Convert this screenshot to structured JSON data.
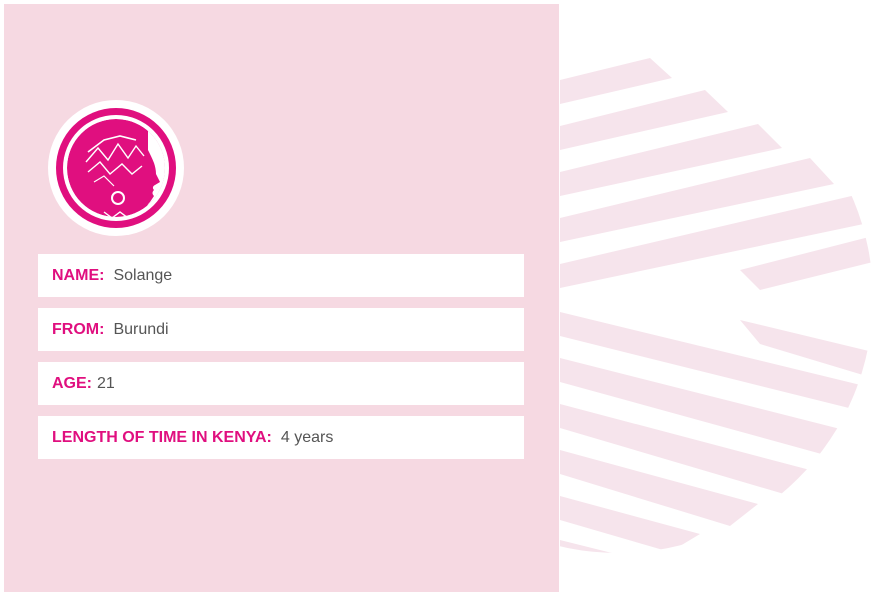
{
  "profile": {
    "avatar_icon": "woman-with-headwrap-icon",
    "fields": [
      {
        "label": "NAME:",
        "value": "Solange"
      },
      {
        "label": "FROM:",
        "value": "Burundi"
      },
      {
        "label": "AGE:",
        "value": "21"
      },
      {
        "label": "LENGTH OF TIME IN KENYA:",
        "value": "4 years"
      }
    ]
  },
  "colors": {
    "card_background": "#f6d9e2",
    "accent": "#e00f7f",
    "stripe": "#f6e4ec",
    "value_text": "#555555"
  }
}
